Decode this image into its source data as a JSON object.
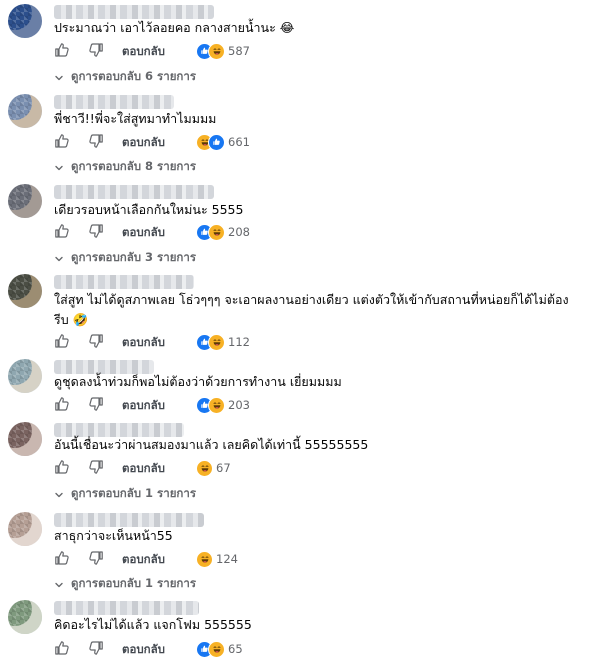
{
  "colors": {
    "like": "#1877f2",
    "haha": "#f7b125",
    "meta_text": "#65676b",
    "body_text": "#050505"
  },
  "icons": {
    "like": "thumbs-up-icon",
    "dislike": "thumbs-down-icon",
    "reply_chevron": "chevron-down-icon",
    "reaction_like": "like-reaction-icon",
    "reaction_haha": "haha-reaction-icon"
  },
  "comments": [
    {
      "text": "ประมาณว่า เอาไว้ลอยคอ กลางสายน้ำนะ 😂",
      "reply_label": "ตอบกลับ",
      "reactions": [
        "like",
        "haha"
      ],
      "count": "587",
      "view_replies": "ดูการตอบกลับ 6 รายการ",
      "avatar_colors": [
        "#2c4f8c",
        "#6a7fa6"
      ]
    },
    {
      "text": "พี่ชาวี!!พี่จะใส่สูทมาทำไมมมม",
      "reply_label": "ตอบกลับ",
      "reactions": [
        "haha",
        "like"
      ],
      "count": "661",
      "view_replies": "ดูการตอบกลับ 8 รายการ",
      "avatar_colors": [
        "#7a8fb0",
        "#c8b9a6"
      ]
    },
    {
      "text": "เดียวรอบหน้าเลือกกันใหม่นะ 5555",
      "reply_label": "ตอบกลับ",
      "reactions": [
        "like",
        "haha"
      ],
      "count": "208",
      "view_replies": "ดูการตอบกลับ 3 รายการ",
      "avatar_colors": [
        "#6b6e78",
        "#a39a94"
      ]
    },
    {
      "text": "ใส่สูท ไม่ได้ดูสภาพเลย โธ่วๆๆๆ จะเอาผลงานอย่างเดียว แต่งตัวให้เข้ากับสถานที่หน่อยก็ได้ไม่ต้องรีบ 🤣",
      "reply_label": "ตอบกลับ",
      "reactions": [
        "like",
        "haha"
      ],
      "count": "112",
      "view_replies": "",
      "avatar_colors": [
        "#4b4e44",
        "#9c8d72"
      ]
    },
    {
      "text": "ดูชุดลงน้ำท่วมก็พอไม่ต้องว่าด้วยการทำงาน เยี่ยมมมม",
      "reply_label": "ตอบกลับ",
      "reactions": [
        "like",
        "haha"
      ],
      "count": "203",
      "view_replies": "",
      "avatar_colors": [
        "#8fa7b0",
        "#d6d2c6"
      ]
    },
    {
      "text": "อันนี้เชื่อนะว่าผ่านสมองมาแล้ว เลยคิดได้เท่านี้ 55555555",
      "reply_label": "ตอบกลับ",
      "reactions": [
        "haha"
      ],
      "count": "67",
      "view_replies": "ดูการตอบกลับ 1 รายการ",
      "avatar_colors": [
        "#7a6360",
        "#c9b7b0"
      ]
    },
    {
      "text": "สาธุกว่าจะเห็นหน้า55",
      "reply_label": "ตอบกลับ",
      "reactions": [
        "haha"
      ],
      "count": "124",
      "view_replies": "ดูการตอบกลับ 1 รายการ",
      "avatar_colors": [
        "#b59f95",
        "#e2d6cf"
      ]
    },
    {
      "text": "คิดอะไรไม่ได้แล้ว แจกโฟม 555555",
      "reply_label": "ตอบกลับ",
      "reactions": [
        "like",
        "haha"
      ],
      "count": "65",
      "view_replies": "",
      "avatar_colors": [
        "#7f9a7e",
        "#cfd5c7"
      ]
    }
  ]
}
